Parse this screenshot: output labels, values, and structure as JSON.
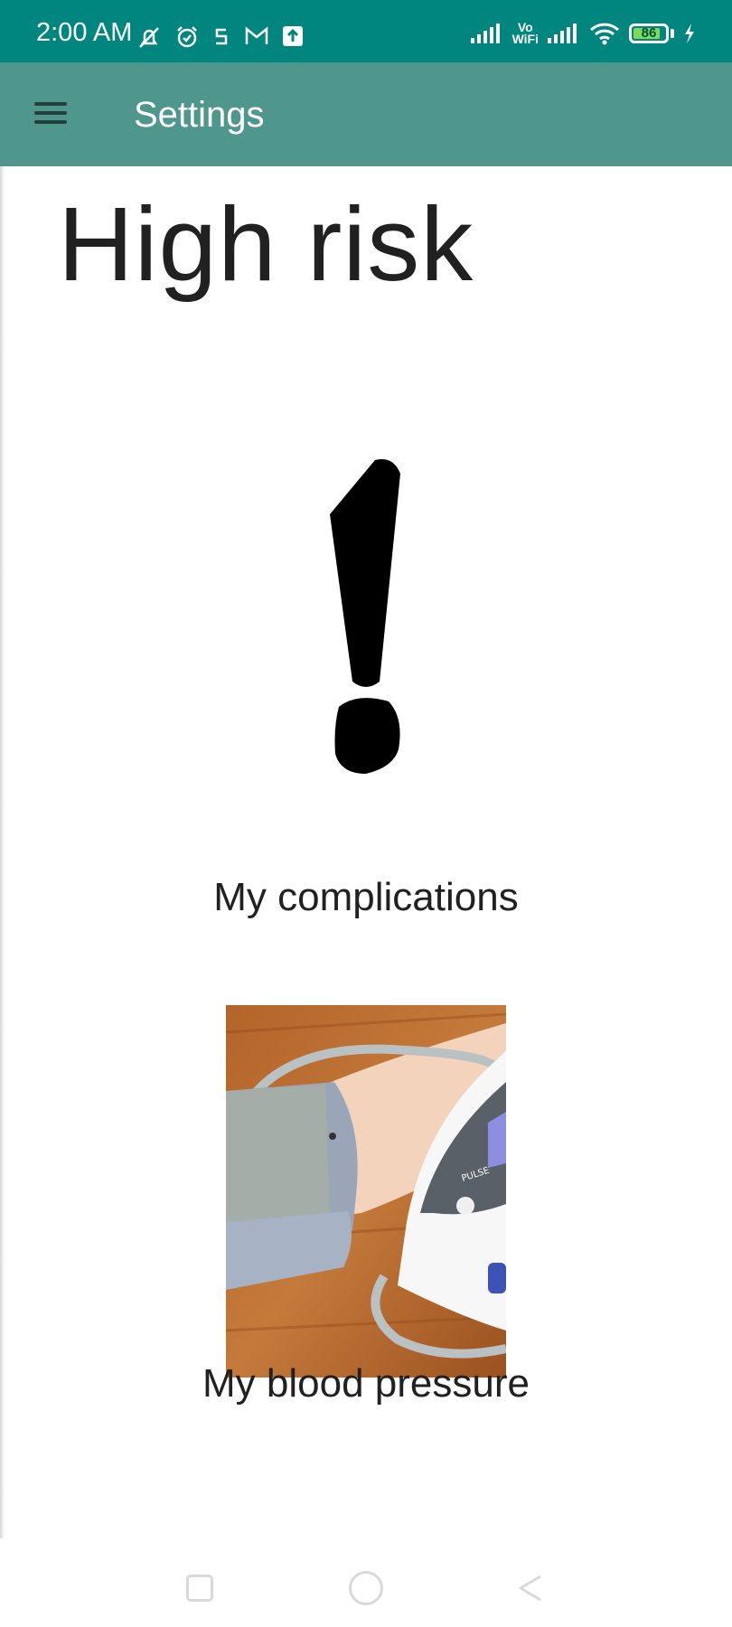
{
  "status_bar": {
    "time": "2:00 AM",
    "icons_left": [
      "mute-icon",
      "alarm-icon",
      "s-icon",
      "gmail-icon",
      "upload-icon"
    ],
    "icons_right": [
      "signal-icon",
      "vowifi-icon",
      "signal-icon",
      "wifi-icon",
      "battery-icon",
      "charging-icon"
    ],
    "vowifi_top": "Vo",
    "vowifi_bottom": "WiFi",
    "battery_percent": "86",
    "battery_level": 0.86
  },
  "app_bar": {
    "title": "Settings",
    "menu_icon": "hamburger-menu-icon"
  },
  "main": {
    "risk_title": "High risk",
    "risk_icon": "exclamation-icon",
    "complications_label": "My complications",
    "blood_pressure_image": "blood-pressure-monitor-photo",
    "blood_pressure_label": "My blood pressure"
  },
  "nav_bar": {
    "buttons": [
      "recent-apps-button",
      "home-button",
      "back-button"
    ]
  },
  "colors": {
    "status_bar": "#00867f",
    "app_bar": "#4f978d",
    "text": "#212121",
    "battery_fill": "#7ed957"
  }
}
